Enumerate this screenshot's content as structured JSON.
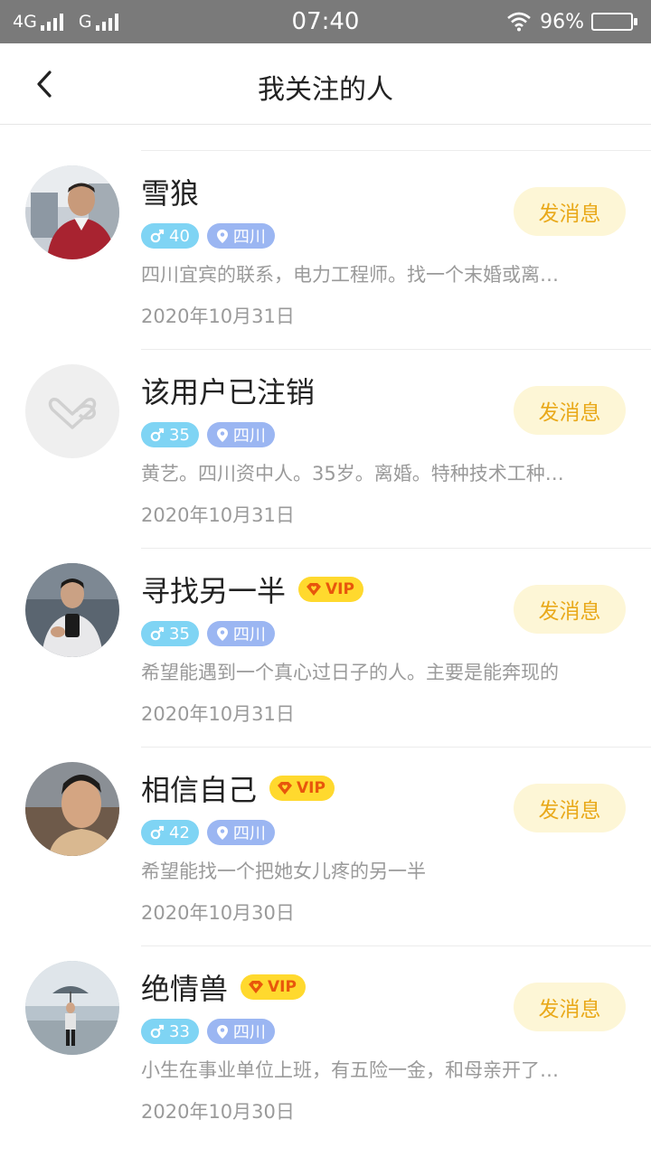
{
  "status_bar": {
    "network_1": "4G",
    "network_2": "G",
    "time": "07:40",
    "battery": "96%"
  },
  "nav": {
    "title": "我关注的人"
  },
  "follows": [
    {
      "name": "雪狼",
      "vip": false,
      "age": "40",
      "location": "四川",
      "bio": "四川宜宾的联系，电力工程师。找一个末婚或离…",
      "date": "2020年10月31日",
      "button": "发消息"
    },
    {
      "name": "该用户已注销",
      "vip": false,
      "age": "35",
      "location": "四川",
      "bio": "黄艺。四川资中人。35岁。离婚。特种技术工种…",
      "date": "2020年10月31日",
      "button": "发消息"
    },
    {
      "name": "寻找另一半",
      "vip": true,
      "vip_label": "VIP",
      "age": "35",
      "location": "四川",
      "bio": "希望能遇到一个真心过日子的人。主要是能奔现的",
      "date": "2020年10月31日",
      "button": "发消息"
    },
    {
      "name": "相信自己",
      "vip": true,
      "vip_label": "VIP",
      "age": "42",
      "location": "四川",
      "bio": "希望能找一个把她女儿疼的另一半",
      "date": "2020年10月30日",
      "button": "发消息"
    },
    {
      "name": "绝情兽",
      "vip": true,
      "vip_label": "VIP",
      "age": "33",
      "location": "四川",
      "bio": "小生在事业单位上班，有五险一金，和母亲开了…",
      "date": "2020年10月30日",
      "button": "发消息"
    }
  ],
  "colors": {
    "vip_badge": "#ffd92e",
    "vip_text": "#e8560c",
    "age_tag": "#7fd4f4",
    "location_tag": "#9bb6f2",
    "message_button_bg": "#fdf6d6",
    "message_button_text": "#e9a91a"
  }
}
